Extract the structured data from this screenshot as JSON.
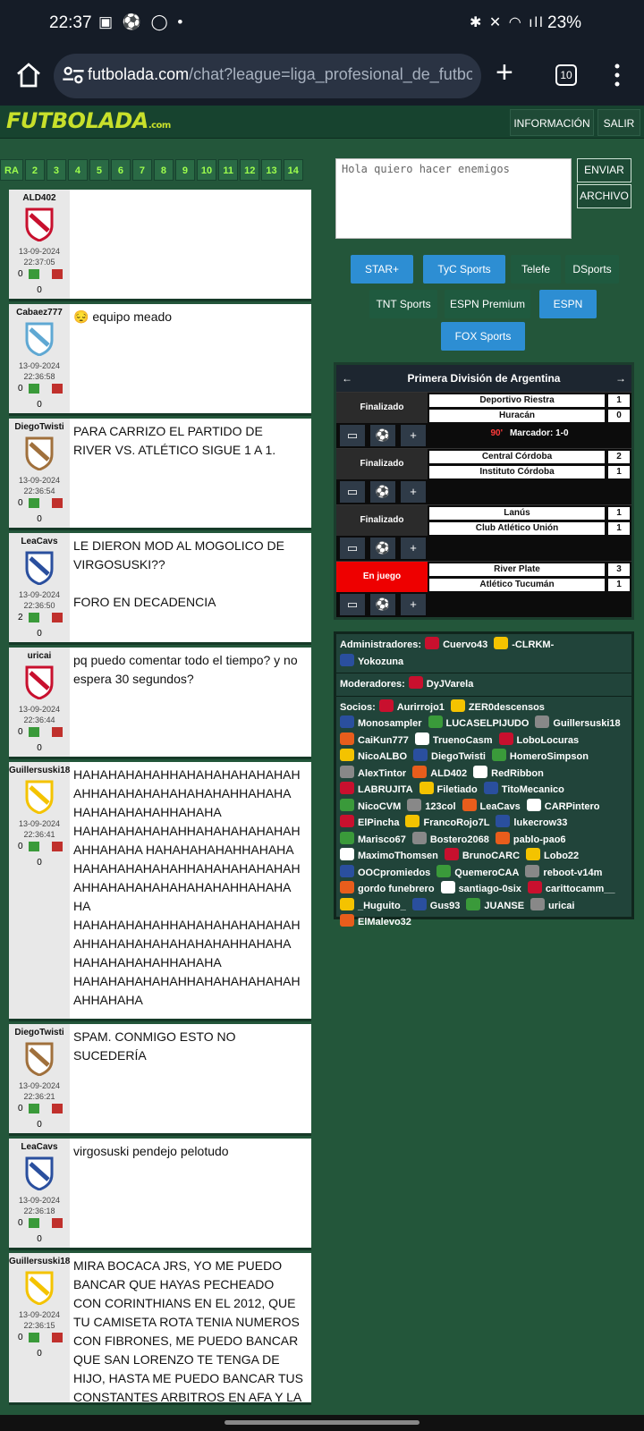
{
  "status": {
    "time": "22:37",
    "battery": "23%"
  },
  "browser": {
    "url_host": "futbolada.com",
    "url_rest": "/chat?league=liga_profesional_de_futbol&co",
    "tab_count": "10"
  },
  "site": {
    "logo": "FUTBOLADA",
    "logo_suffix": ".com",
    "btn_info": "INFORMACIÓN",
    "btn_exit": "SALIR"
  },
  "pager": [
    "RA",
    "2",
    "3",
    "4",
    "5",
    "6",
    "7",
    "8",
    "9",
    "10",
    "11",
    "12",
    "13",
    "14"
  ],
  "compose": {
    "text": "Hola quiero hacer enemigos",
    "send": "ENVIAR",
    "file": "ARCHIVO"
  },
  "channels": [
    {
      "label": "STAR+",
      "active": true
    },
    {
      "label": "TyC Sports",
      "active": true
    },
    {
      "label": "Telefe",
      "active": false
    },
    {
      "label": "DSports",
      "active": false
    },
    {
      "label": "TNT Sports",
      "active": false
    },
    {
      "label": "ESPN Premium",
      "active": false
    },
    {
      "label": "ESPN",
      "active": true
    },
    {
      "label": "FOX Sports",
      "active": true
    }
  ],
  "league": {
    "title": "Primera División de Argentina"
  },
  "matches": [
    {
      "status": "Finalizado",
      "home": "Deportivo Riestra",
      "away": "Huracán",
      "hs": "1",
      "as": "0",
      "minute": "90'",
      "extra": "Marcador: 1-0"
    },
    {
      "status": "Finalizado",
      "home": "Central Córdoba",
      "away": "Instituto Córdoba",
      "hs": "2",
      "as": "1",
      "minute": "",
      "extra": ""
    },
    {
      "status": "Finalizado",
      "home": "Lanús",
      "away": "Club Atlético Unión",
      "hs": "1",
      "as": "1",
      "minute": "",
      "extra": ""
    },
    {
      "status": "En juego",
      "home": "River Plate",
      "away": "Atlético Tucumán",
      "hs": "3",
      "as": "1",
      "minute": "",
      "extra": ""
    }
  ],
  "users": {
    "admins_label": "Administradores:",
    "admins": [
      "Cuervo43",
      "-CLRKM-",
      "Yokozuna"
    ],
    "mods_label": "Moderadores:",
    "mods": [
      "DyJVarela"
    ],
    "members_label": "Socios:",
    "members": [
      "Aurirrojo1",
      "ZER0descensos",
      "Monosampler",
      "LUCASELPIJUDO",
      "Guillersuski18",
      "CaiKun777",
      "TruenoCasm",
      "LoboLocuras",
      "NicoALBO",
      "DiegoTwisti",
      "HomeroSimpson",
      "AlexTintor",
      "ALD402",
      "RedRibbon",
      "LABRUJITA",
      "Filetiado",
      "TitoMecanico",
      "NicoCVM",
      "123col",
      "LeaCavs",
      "CARPintero",
      "ElPincha",
      "FrancoRojo7L",
      "lukecrow33",
      "Marisco67",
      "Bostero2068",
      "pablo-pao6",
      "MaximoThomsen",
      "BrunoCARC",
      "Lobo22",
      "OOCpromiedos",
      "QuemeroCAA",
      "reboot-v14m",
      "gordo funebrero",
      "santiago-0six",
      "carittocamm__",
      "_Huguito_",
      "Gus93",
      "JUANSE",
      "uricai",
      "ElMalevo32"
    ]
  },
  "messages": [
    {
      "user": "ALD402",
      "date": "13-09-2024",
      "time": "22:37:05",
      "score": "0",
      "total": "0",
      "text": ""
    },
    {
      "user": "Cabaez777",
      "date": "13-09-2024",
      "time": "22:36:58",
      "score": "0",
      "total": "0",
      "text": "😔 equipo meado"
    },
    {
      "user": "DiegoTwisti",
      "date": "13-09-2024",
      "time": "22:36:54",
      "score": "0",
      "total": "0",
      "text": "PARA CARRIZO EL PARTIDO DE RIVER VS. ATLÉTICO SIGUE 1 A 1."
    },
    {
      "user": "LeaCavs",
      "date": "13-09-2024",
      "time": "22:36:50",
      "score": "2",
      "total": "0",
      "text": "LE DIERON MOD AL MOGOLICO DE VIRGOSUSKI??\n\nFORO EN DECADENCIA"
    },
    {
      "user": "uricai",
      "date": "13-09-2024",
      "time": "22:36:44",
      "score": "0",
      "total": "0",
      "text": "pq puedo comentar todo el tiempo? y no espera 30 segundos?"
    },
    {
      "user": "Guillersuski18",
      "date": "13-09-2024",
      "time": "22:36:41",
      "score": "0",
      "total": "0",
      "text": "HAHAHAHAHAHHAHAHAHAHAHAHAH AHHAHAHAHAHAHAHAHAHHAHAHA HAHAHAHAHAHHAHAHA HAHAHAHAHAHAHHAHAHAHAHAHAH AHHAHAHA HAHAHAHAHAHHAHAHA HAHAHAHAHAHAHHAHAHAHAHAHAH AHHAHAHAHAHAHAHAHAHHAHAHA HA HAHAHAHAHAHHAHAHAHAHAHAHAH AHHAHAHAHAHAHAHAHAHHAHAHA HAHAHAHAHAHHAHAHA HAHAHAHAHAHAHHAHAHAHAHAHAH AHHAHAHA"
    },
    {
      "user": "DiegoTwisti",
      "date": "13-09-2024",
      "time": "22:36:21",
      "score": "0",
      "total": "0",
      "text": "SPAM. CONMIGO ESTO NO SUCEDERÍA"
    },
    {
      "user": "LeaCavs",
      "date": "13-09-2024",
      "time": "22:36:18",
      "score": "0",
      "total": "0",
      "text": "virgosuski pendejo pelotudo"
    },
    {
      "user": "Guillersuski18",
      "date": "13-09-2024",
      "time": "22:36:15",
      "score": "0",
      "total": "0",
      "text": "MIRA BOCACA JRS, YO ME PUEDO BANCAR QUE HAYAS PECHEADO CON CORINTHIANS EN EL 2012, QUE TU CAMISETA ROTA TENIA NUMEROS CON FIBRONES, ME PUEDO BANCAR QUE SAN LORENZO TE TENGA DE HIJO, HASTA ME PUEDO BANCAR TUS CONSTANTES ARBITROS EN AFA Y LA"
    }
  ],
  "colors": {
    "accent": "#2d8ed3",
    "live": "#e00000",
    "bg": "#23563a"
  }
}
